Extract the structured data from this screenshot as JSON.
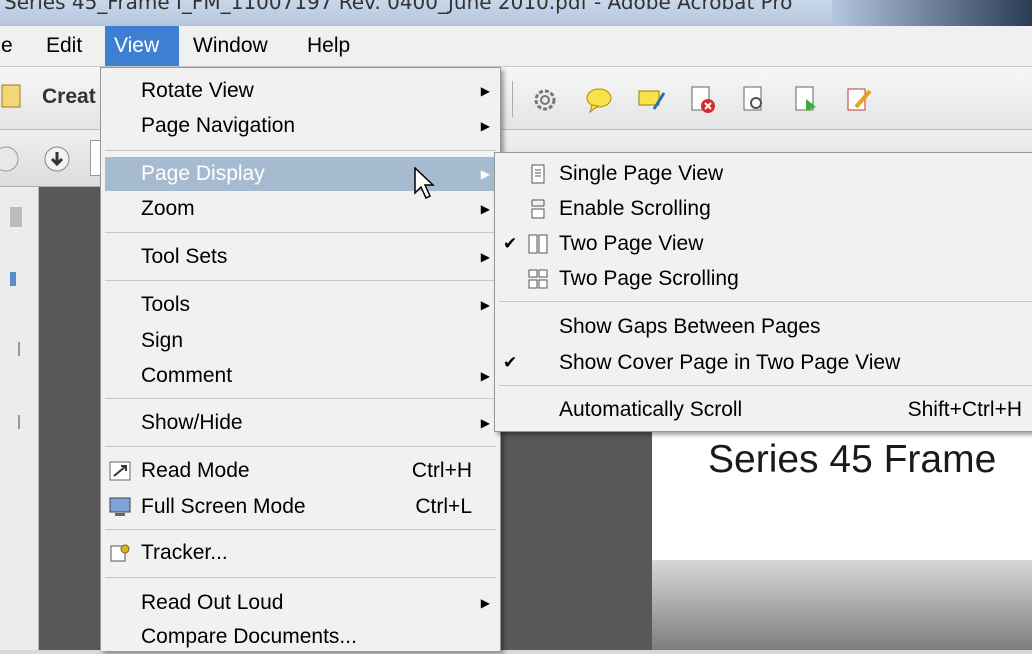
{
  "window": {
    "title": "Series 45_Frame I_FM_11007197 Rev. 0400_June 2010.pdf - Adobe Acrobat Pro"
  },
  "menubar": [
    {
      "label": "e"
    },
    {
      "label": "Edit"
    },
    {
      "label": "View"
    },
    {
      "label": "Window"
    },
    {
      "label": "Help"
    }
  ],
  "toolbar": {
    "create_label": "Creat"
  },
  "view_menu": {
    "rotate_view": "Rotate View",
    "page_navigation": "Page Navigation",
    "page_display": "Page Display",
    "zoom": "Zoom",
    "tool_sets": "Tool Sets",
    "tools": "Tools",
    "sign": "Sign",
    "comment": "Comment",
    "show_hide": "Show/Hide",
    "read_mode": "Read Mode",
    "read_mode_sc": "Ctrl+H",
    "full_screen": "Full Screen Mode",
    "full_screen_sc": "Ctrl+L",
    "tracker": "Tracker...",
    "read_out_loud": "Read Out Loud",
    "compare": "Compare Documents..."
  },
  "page_display_menu": {
    "single_page": "Single Page View",
    "enable_scrolling": "Enable Scrolling",
    "two_page": "Two Page View",
    "two_page_scrolling": "Two Page Scrolling",
    "show_gaps": "Show Gaps Between Pages",
    "show_cover": "Show Cover Page in Two Page View",
    "auto_scroll": "Automatically Scroll",
    "auto_scroll_sc": "Shift+Ctrl+H",
    "checked": [
      "Two Page View",
      "Show Cover Page in Two Page View"
    ]
  },
  "document": {
    "heading": "Series 45 Frame"
  },
  "colors": {
    "highlight": "#a7bbd0",
    "menubar_active": "#3d7fd0",
    "menu_bg": "#f1f1f1"
  }
}
